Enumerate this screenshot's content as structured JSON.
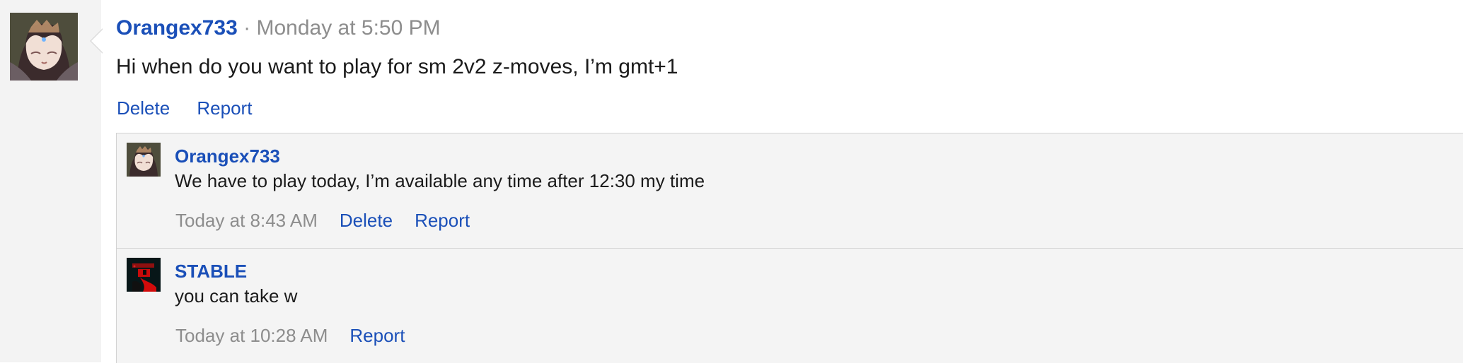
{
  "post": {
    "author": "Orangex733",
    "separator": "·",
    "timestamp": "Monday at 5:50 PM",
    "message": "Hi when do you want to play for sm 2v2 z-moves, I’m gmt+1",
    "actions": {
      "delete": "Delete",
      "report": "Report"
    },
    "avatar_icon": "anime-character-avatar-icon"
  },
  "comments": [
    {
      "author": "Orangex733",
      "text": "We have to play today, I’m available any time after 12:30 my time",
      "timestamp": "Today at 8:43 AM",
      "actions": {
        "delete": "Delete",
        "report": "Report"
      },
      "avatar_icon": "anime-character-avatar-icon"
    },
    {
      "author": "STABLE",
      "text": "you can take w",
      "timestamp": "Today at 10:28 AM",
      "actions": {
        "report": "Report"
      },
      "avatar_icon": "dark-red-avatar-icon"
    }
  ],
  "colors": {
    "link": "#1a4fb8",
    "muted": "#8d8d8d",
    "text": "#1b1b1b",
    "rail": "#f3f3f3",
    "comment_bg": "#f4f4f4",
    "border": "#d2d2d2"
  }
}
